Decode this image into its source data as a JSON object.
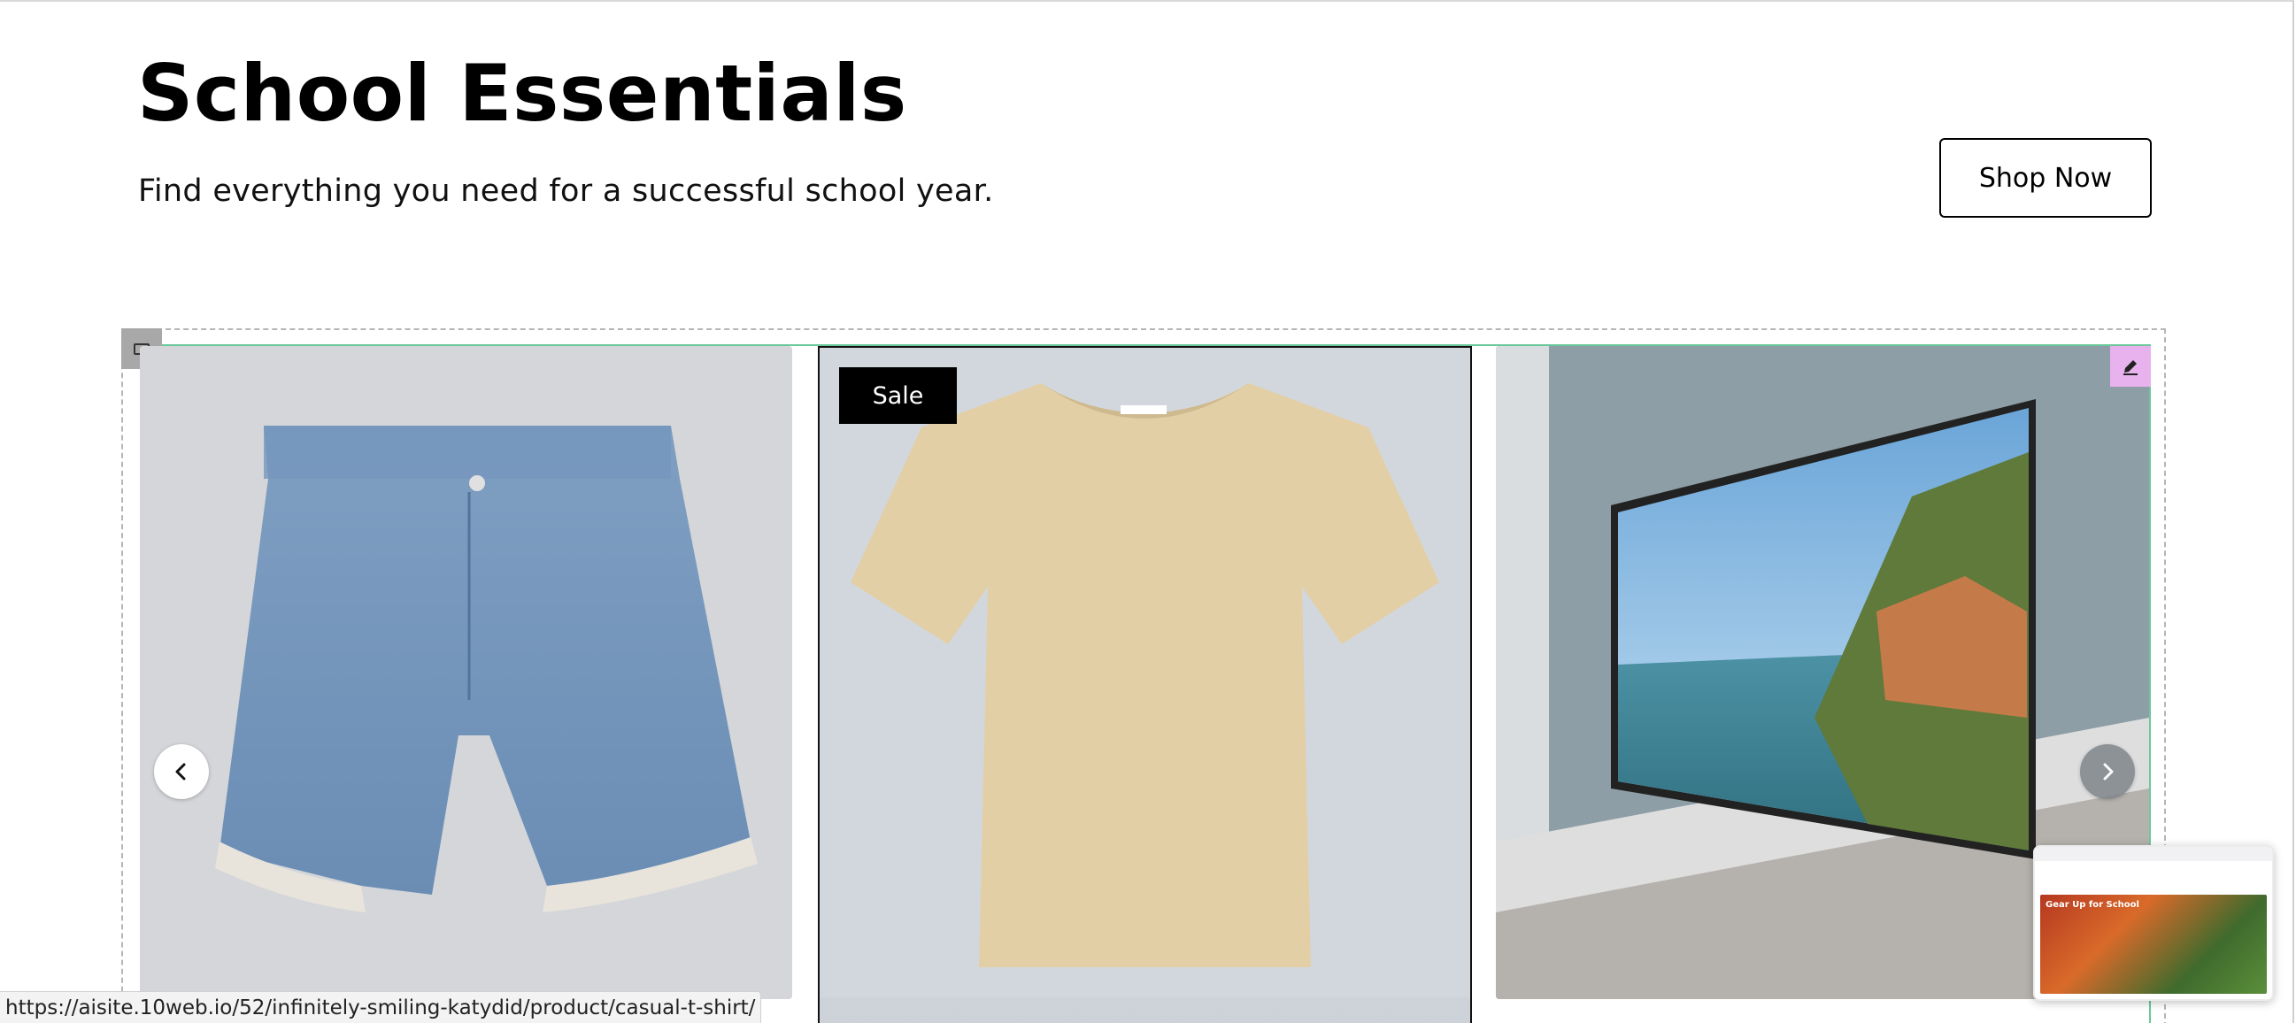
{
  "hero": {
    "title": "School Essentials",
    "subtitle": "Find everything you need for a successful school year.",
    "cta_label": "Shop Now"
  },
  "carousel": {
    "products": [
      {
        "image": "denim-shorts-image"
      },
      {
        "image": "beige-tshirt-image",
        "badge": "Sale"
      },
      {
        "image": "television-image"
      }
    ],
    "prev_icon": "chevron-left-icon",
    "next_icon": "chevron-right-icon",
    "edit_icon": "pencil-icon"
  },
  "preview": {
    "hero_text": "Gear Up for School"
  },
  "status_bar": {
    "url": "https://aisite.10web.io/52/infinitely-smiling-katydid/product/casual-t-shirt/"
  },
  "colors": {
    "cta_border": "#000000",
    "sale_badge_bg": "#000000",
    "edit_button_bg": "#e7b2ee",
    "active_outline": "#6cc89b"
  }
}
